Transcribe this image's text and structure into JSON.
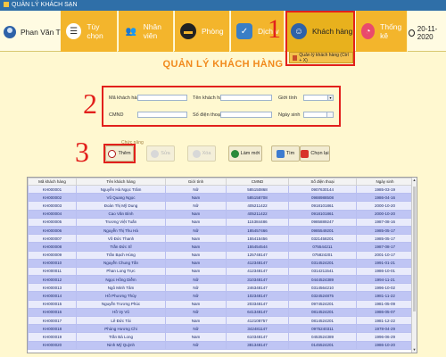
{
  "window": {
    "title": "QUẢN LÝ KHÁCH SẠN"
  },
  "header": {
    "user_name": "Phan Văn Thông",
    "nav": [
      {
        "label": "Tùy chọn",
        "icon": "list-icon"
      },
      {
        "label": "Nhân viên",
        "icon": "people-icon"
      },
      {
        "label": "Phòng",
        "icon": "bed-icon"
      },
      {
        "label": "Dịch v",
        "icon": "service-icon"
      },
      {
        "label": "Khách hàng",
        "icon": "customer-icon"
      },
      {
        "label": "Thống kê",
        "icon": "chart-icon"
      }
    ],
    "date": "20-11-2020",
    "submenu_label": "Quản lý khách hàng (Ctrl + X)"
  },
  "annotations": {
    "n1": "1",
    "n2": "2",
    "n3": "3"
  },
  "page_title": "QUẢN LÝ KHÁCH HÀNG",
  "form": {
    "ma_label": "Mã khách hàng",
    "ten_label": "Tên khách hàng",
    "gioitinh_label": "Giới tính",
    "cmnd_label": "CMND",
    "sdt_label": "Số điện thoại",
    "ngaysinh_label": "Ngày sinh"
  },
  "buttons": {
    "group_label": "Chức năng",
    "them": "Thêm",
    "sua": "Sửa",
    "xoa": "Xóa",
    "lammoi": "Làm mới",
    "tim": "Tìm",
    "chonlai": "Chọn lại"
  },
  "table": {
    "headers": [
      "Mã khách hàng",
      "Tên khách hàng",
      "Giới tính",
      "CMND",
      "Số điện thoại",
      "Ngày sinh"
    ],
    "rows": [
      [
        "KH000001",
        "Nguyễn Hà Ngọc Trâm",
        "Nữ",
        "585150868",
        "0907630144",
        "1985-03-19"
      ],
      [
        "KH000002",
        "Vũ Quang Ngọc",
        "Nam",
        "585158708",
        "0988988508",
        "1986-04-16"
      ],
      [
        "KH000003",
        "Đoàn Thị Mỹ Dung",
        "Nữ",
        "405211422",
        "0918101861",
        "2000-10-20"
      ],
      [
        "KH000004",
        "Cao Văn Bình",
        "Nam",
        "405211422",
        "0918101861",
        "2000-10-20"
      ],
      [
        "KH000005",
        "Trương Việt Tuấn",
        "Nam",
        "115384486",
        "0985889247",
        "1987-08-16"
      ],
      [
        "KH000006",
        "Nguyễn Thị Thu Hà",
        "Nữ",
        "185457466",
        "0985549201",
        "1985-05-17"
      ],
      [
        "KH000007",
        "Võ Đức Thanh",
        "Nam",
        "155415456",
        "0321458201",
        "1985-05-17"
      ],
      [
        "KH000008",
        "Trần Đức Sĩ",
        "Nam",
        "155454544",
        "075544211",
        "1987-08-17"
      ],
      [
        "KH000009",
        "Trần Bạch Hùng",
        "Nam",
        "125748147",
        "075824201",
        "2001-10-17"
      ],
      [
        "KH000010",
        "Nguyễn Chung Tấn",
        "Nam",
        "412348147",
        "0314524201",
        "1991-01-21"
      ],
      [
        "KH000011",
        "Phan Long Trực",
        "Nam",
        "412348147",
        "0314211541",
        "1986-10-01"
      ],
      [
        "KH000012",
        "Ngọc Hồng Diễm",
        "Nữ",
        "310348147",
        "0444524389",
        "1994-11-21"
      ],
      [
        "KH000013",
        "Ngô Minh Tâm",
        "Nữ",
        "246348147",
        "0314564210",
        "1996-10-02"
      ],
      [
        "KH000014",
        "Hồ Phương Thùy",
        "Nữ",
        "102348147",
        "0324524875",
        "1981-11-22"
      ],
      [
        "KH000015",
        "Nguyễn Trương Phúc",
        "Nam",
        "203348147",
        "0974524201",
        "1981-05-09"
      ],
      [
        "KH000016",
        "Hồ Vy Vũ",
        "Nữ",
        "641348147",
        "0814524201",
        "1986-05-07"
      ],
      [
        "KH000017",
        "Lê Đức Tài",
        "Nam",
        "412108757",
        "0814524201",
        "1981-12-22"
      ],
      [
        "KH000018",
        "Phùng Hương Chi",
        "Nữ",
        "342481147",
        "0975240311",
        "1978-04-29"
      ],
      [
        "KH000019",
        "Trần Bá Long",
        "Nam",
        "610348147",
        "0453524389",
        "1996-06-29"
      ],
      [
        "KH000020",
        "Ninh Mỹ Quỳnh",
        "Nữ",
        "381348147",
        "0145524201",
        "1986-10-20"
      ]
    ]
  }
}
